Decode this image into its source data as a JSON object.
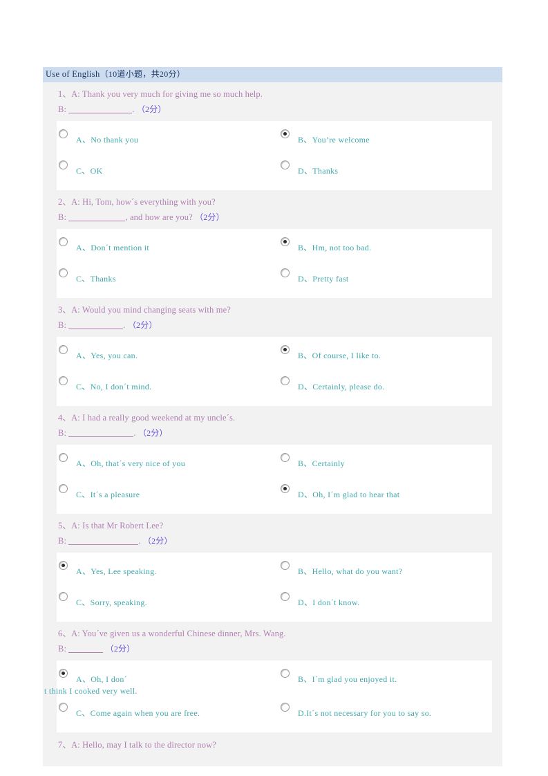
{
  "section": {
    "title_en": "Use of English",
    "title_meta": "（10道小题，共20分）"
  },
  "colors": {
    "header_bg": "#cddcef",
    "header_text": "#1f3864",
    "stem_text": "#b07fb0",
    "option_text": "#41a8ab",
    "score_text": "#6b4fd8",
    "body_bg": "#f2f2f2",
    "option_box_bg": "#ffffff"
  },
  "questions": [
    {
      "number": "1、",
      "line1": "A: Thank you very much for giving me so much help.",
      "line2_prefix": "B:",
      "blank_width": 92,
      "line2_suffix": ".",
      "score": "（2分）",
      "options": [
        {
          "label": "A、No  thank  you",
          "checked": false
        },
        {
          "label": "B、You’re  welcome",
          "checked": true
        },
        {
          "label": "C、OK",
          "checked": false
        },
        {
          "label": "D、Thanks",
          "checked": false
        }
      ]
    },
    {
      "number": "2、",
      "line1": "A: Hi, Tom, how´s everything with you?",
      "line2_prefix": "B:",
      "blank_width": 82,
      "line2_suffix": ", and how are you?",
      "score": "（2分）",
      "options": [
        {
          "label": "A、Don´t  mention  it",
          "checked": false
        },
        {
          "label": "B、Hm, not too bad.",
          "checked": true
        },
        {
          "label": "C、Thanks",
          "checked": false
        },
        {
          "label": "D、Pretty  fast",
          "checked": false
        }
      ]
    },
    {
      "number": "3、",
      "line1": "A: Would you mind changing seats with me?",
      "line2_prefix": "B:",
      "blank_width": 79,
      "line2_suffix": ".",
      "score": "（2分）",
      "options": [
        {
          "label": "A、Yes,  you  can.",
          "checked": false
        },
        {
          "label": "B、Of  course,  I  like  to.",
          "checked": true
        },
        {
          "label": "C、No,  I  don´t  mind.",
          "checked": false
        },
        {
          "label": "D、Certainly,  please  do.",
          "checked": false
        }
      ]
    },
    {
      "number": "4、",
      "line1": "A: I had a really good weekend at my uncle´s.",
      "line2_prefix": "B:",
      "blank_width": 94,
      "line2_suffix": ".",
      "score": "（2分）",
      "options": [
        {
          "label": "A、Oh,  that´s  very  nice  of  you",
          "checked": false
        },
        {
          "label": "B、Certainly",
          "checked": false
        },
        {
          "label": "C、It´s  a  pleasure",
          "checked": false
        },
        {
          "label": "D、Oh,  I´m  glad  to  hear  that",
          "checked": true
        }
      ]
    },
    {
      "number": "5、",
      "line1": "A: Is that Mr Robert Lee?",
      "line2_prefix": "B:",
      "blank_width": 101,
      "line2_suffix": ".",
      "score": "（2分）",
      "options": [
        {
          "label": "A、Yes,  Lee  speaking.",
          "checked": true
        },
        {
          "label": "B、Hello,  what  do  you  want?",
          "checked": false
        },
        {
          "label": "C、Sorry,   speaking.",
          "checked": false
        },
        {
          "label": "D、I  don´t  know.",
          "checked": false
        }
      ]
    },
    {
      "number": "6、",
      "line1": "A: You´ve given us a wonderful Chinese dinner, Mrs. Wang.",
      "line2_prefix": "B:",
      "blank_width": 50,
      "line2_suffix": "",
      "score": "（2分）",
      "options": [
        {
          "label": "A、Oh,  I  don´",
          "label_wrap": "t  think  I  cooked  very  well.",
          "checked": true
        },
        {
          "label": "B、I´m  glad  you  enjoyed  it.",
          "checked": false
        },
        {
          "label": "C、Come  again  when  you  are  free.",
          "checked": false
        },
        {
          "label": "D.It´s  not  necessary  for  you  to  say  so.",
          "checked": false
        }
      ]
    }
  ],
  "trailing_question": {
    "number": "7、",
    "line1": "A: Hello, may I talk to the director now?"
  }
}
